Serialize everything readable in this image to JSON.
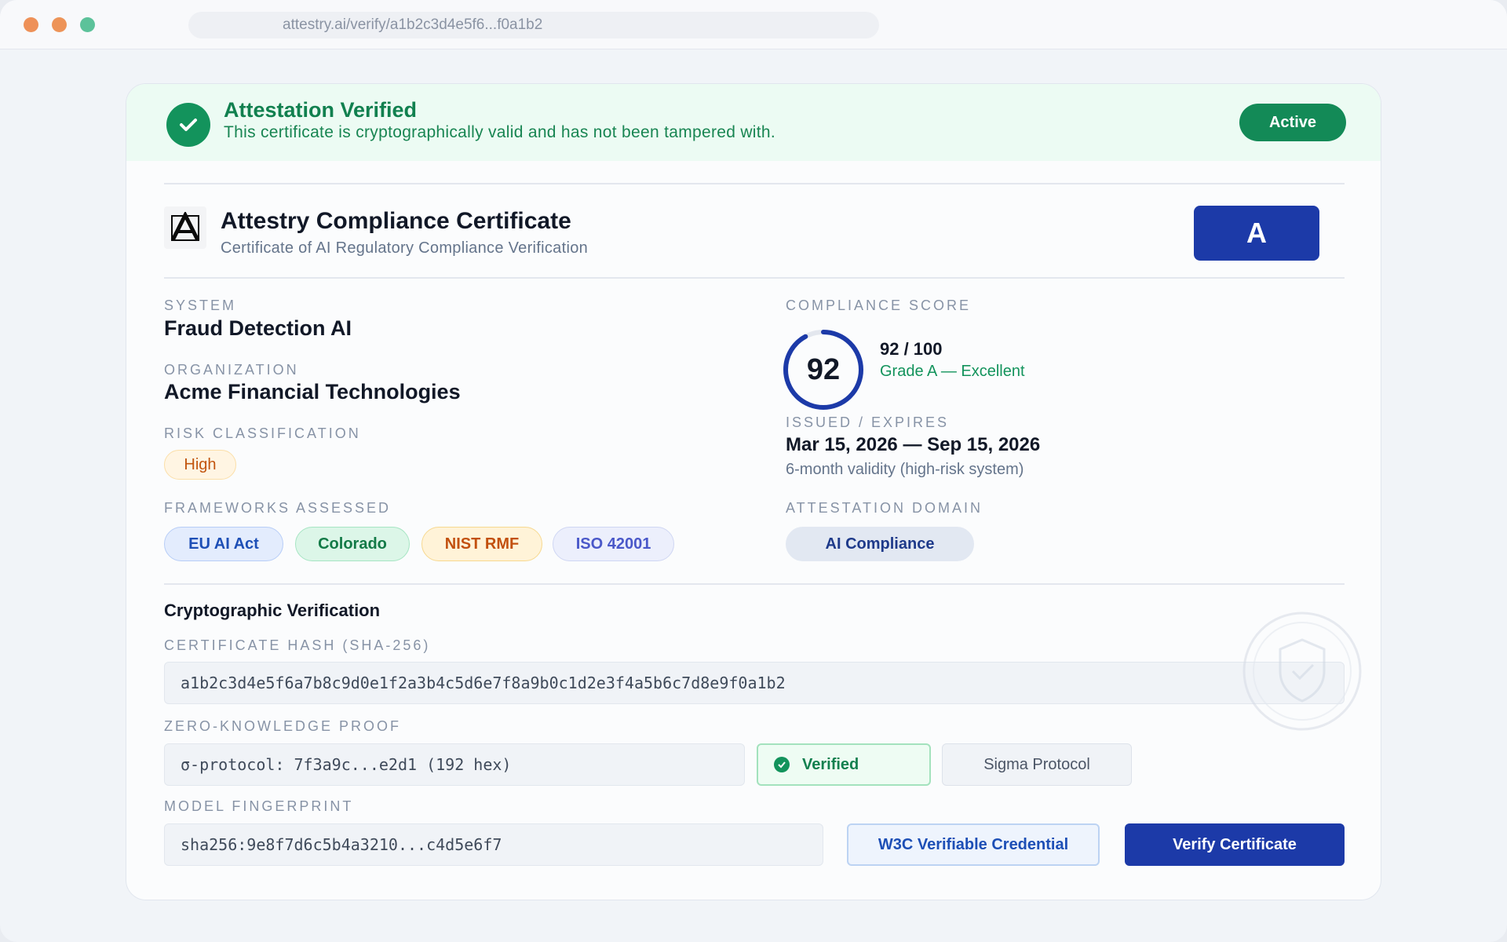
{
  "browser": {
    "url": "attestry.ai/verify/a1b2c3d4e5f6...f0a1b2"
  },
  "banner": {
    "title": "Attestation Verified",
    "subtitle": "This certificate is cryptographically valid and has not been tampered with.",
    "status": "Active"
  },
  "certificate": {
    "logo_letter": "A",
    "title": "Attestry Compliance Certificate",
    "subtitle": "Certificate of AI Regulatory Compliance Verification",
    "grade": "A"
  },
  "details": {
    "system_label": "SYSTEM",
    "system_value": "Fraud Detection AI",
    "organization_label": "ORGANIZATION",
    "organization_value": "Acme Financial Technologies",
    "risk_label": "RISK CLASSIFICATION",
    "risk_value": "High",
    "frameworks_label": "FRAMEWORKS ASSESSED",
    "frameworks": [
      "EU AI Act",
      "Colorado",
      "NIST RMF",
      "ISO 42001"
    ]
  },
  "score": {
    "label": "COMPLIANCE SCORE",
    "value": "92",
    "fraction": 0.92,
    "of_text": "92 / 100",
    "grade_text": "Grade A — Excellent"
  },
  "validity": {
    "label": "ISSUED / EXPIRES",
    "dates": "Mar 15, 2026 — Sep 15, 2026",
    "note": "6-month validity (high-risk system)"
  },
  "domain": {
    "label": "ATTESTATION DOMAIN",
    "value": "AI Compliance"
  },
  "crypto": {
    "title": "Cryptographic Verification",
    "hash_label": "CERTIFICATE HASH (SHA-256)",
    "hash_value": "a1b2c3d4e5f6a7b8c9d0e1f2a3b4c5d6e7f8a9b0c1d2e3f4a5b6c7d8e9f0a1b2",
    "zk_label": "ZERO-KNOWLEDGE PROOF",
    "zk_value": "σ-protocol: 7f3a9c...e2d1 (192 hex)",
    "zk_status": "Verified",
    "zk_protocol": "Sigma Protocol",
    "fingerprint_label": "MODEL FINGERPRINT",
    "fingerprint_value": "sha256:9e8f7d6c5b4a3210...c4d5e6f7",
    "w3c_button": "W3C Verifiable Credential",
    "verify_button": "Verify Certificate"
  },
  "colors": {
    "brand_blue": "#1c3aa8",
    "success_green": "#13935c",
    "banner_bg": "#ecfbf3"
  },
  "icons": [
    "check-circle-icon",
    "attestry-logo-icon",
    "shield-seal-icon",
    "verified-check-icon"
  ]
}
